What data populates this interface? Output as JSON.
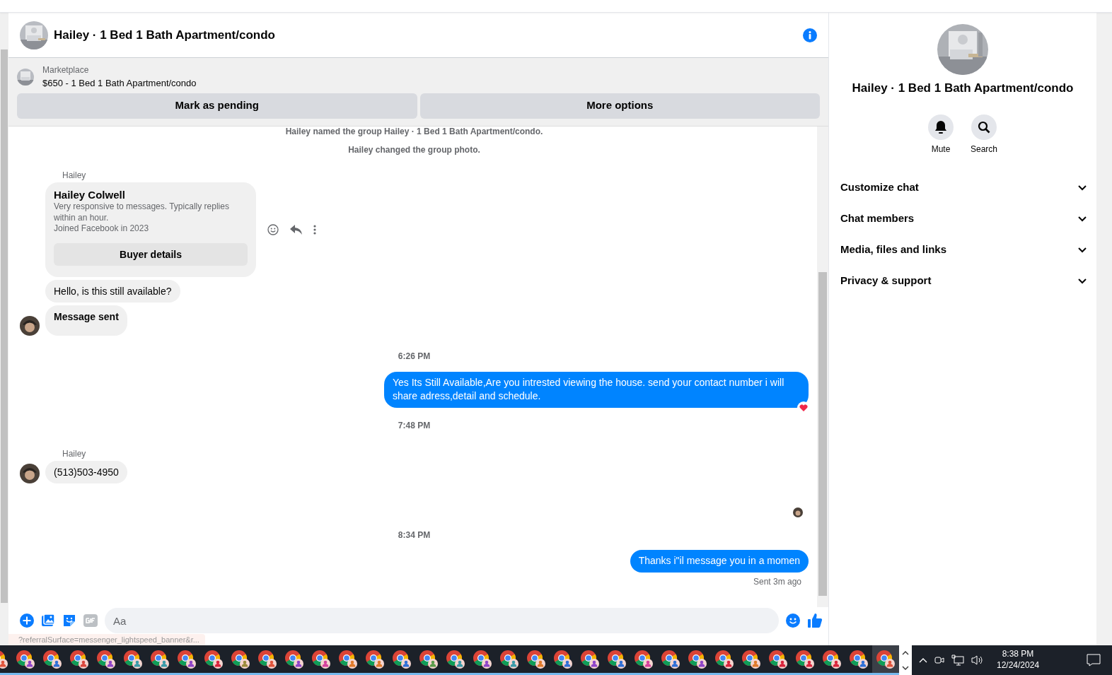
{
  "header": {
    "title": "Hailey · 1 Bed 1 Bath Apartment/condo"
  },
  "listing": {
    "label": "Marketplace",
    "title": "$650 - 1 Bed 1 Bath Apartment/condo",
    "buttons": [
      "Mark as pending",
      "More options"
    ]
  },
  "messages": [
    {
      "kind": "system",
      "text": "Hailey named the group Hailey · 1 Bed 1 Bath Apartment/condo."
    },
    {
      "kind": "system",
      "text": "Hailey changed the group photo."
    },
    {
      "kind": "sender",
      "text": "Hailey"
    },
    {
      "kind": "card",
      "name": "Hailey Colwell",
      "lines": [
        "Very responsive to messages. Typically replies within an hour.",
        "Joined Facebook in 2023"
      ],
      "button": "Buyer details"
    },
    {
      "kind": "incoming",
      "text": "Hello, is this still available?",
      "avatar": false
    },
    {
      "kind": "notice",
      "text": "Message sent",
      "avatar": true
    },
    {
      "kind": "time",
      "text": "6:26 PM"
    },
    {
      "kind": "outgoing",
      "text": "Yes Its Still Available,Are you intrested viewing the house. send your contact number i will share adress,detail and schedule.",
      "reacted": true
    },
    {
      "kind": "time",
      "text": "7:48 PM"
    },
    {
      "kind": "sender",
      "text": "Hailey"
    },
    {
      "kind": "incoming",
      "text": "(513)503-4950",
      "avatar": true
    },
    {
      "kind": "seen"
    },
    {
      "kind": "time",
      "text": "8:34 PM"
    },
    {
      "kind": "outgoing",
      "text": "Thanks i\"il message you in a momen",
      "reacted": false
    },
    {
      "kind": "status",
      "text": "Sent 3m ago"
    }
  ],
  "composer": {
    "placeholder": "Aa"
  },
  "status_url": "?referralSurface=messenger_lightspeed_banner&r...",
  "panel": {
    "title": "Hailey · 1 Bed 1 Bath Apartment/condo",
    "actions": [
      {
        "kind": "bell",
        "label": "Mute"
      },
      {
        "kind": "search",
        "label": "Search"
      }
    ],
    "sections": [
      {
        "label": "Customize chat",
        "expanded": false
      },
      {
        "label": "Chat members",
        "expanded": false
      },
      {
        "label": "Media, files and links",
        "expanded": false
      },
      {
        "label": "Privacy & support",
        "expanded": false
      }
    ]
  },
  "taskbar": {
    "time": "8:38 PM",
    "date": "12/24/2024",
    "apps": [
      {
        "color": "#e0533a",
        "selected": false
      },
      {
        "color": "#8e44c8",
        "selected": false
      },
      {
        "color": "#2f6fd6",
        "selected": false
      },
      {
        "color": "#d9453b",
        "selected": false
      },
      {
        "color": "#8e44c8",
        "selected": false
      },
      {
        "color": "#3a9aa8",
        "selected": false
      },
      {
        "color": "#3a9aa8",
        "selected": false
      },
      {
        "color": "#8e44c8",
        "selected": false
      },
      {
        "color": "#d9243b",
        "selected": false
      },
      {
        "color": "#9a8a3a",
        "selected": false
      },
      {
        "color": "#e0533a",
        "selected": false
      },
      {
        "color": "#8e44c8",
        "selected": false
      },
      {
        "color": "#d63f9c",
        "selected": false
      },
      {
        "color": "#e07a2a",
        "selected": false
      },
      {
        "color": "#e07a2a",
        "selected": false
      },
      {
        "color": "#2f6fd6",
        "selected": false
      },
      {
        "color": "#5a9a4a",
        "selected": false
      },
      {
        "color": "#3a9aa8",
        "selected": false
      },
      {
        "color": "#8e44c8",
        "selected": false
      },
      {
        "color": "#3a9aa8",
        "selected": false
      },
      {
        "color": "#e07a2a",
        "selected": false
      },
      {
        "color": "#2f6fd6",
        "selected": false
      },
      {
        "color": "#8e44c8",
        "selected": false
      },
      {
        "color": "#2f6fd6",
        "selected": false
      },
      {
        "color": "#d63f9c",
        "selected": false
      },
      {
        "color": "#2f6fd6",
        "selected": false
      },
      {
        "color": "#8e44c8",
        "selected": false
      },
      {
        "color": "#d9243b",
        "selected": false
      },
      {
        "color": "#e07a2a",
        "selected": false
      },
      {
        "color": "#d9243b",
        "selected": false
      },
      {
        "color": "#d9243b",
        "selected": false
      },
      {
        "color": "#d9243b",
        "selected": false
      },
      {
        "color": "#2f6fd6",
        "selected": false
      },
      {
        "color": "#e0533a",
        "selected": true
      }
    ]
  }
}
